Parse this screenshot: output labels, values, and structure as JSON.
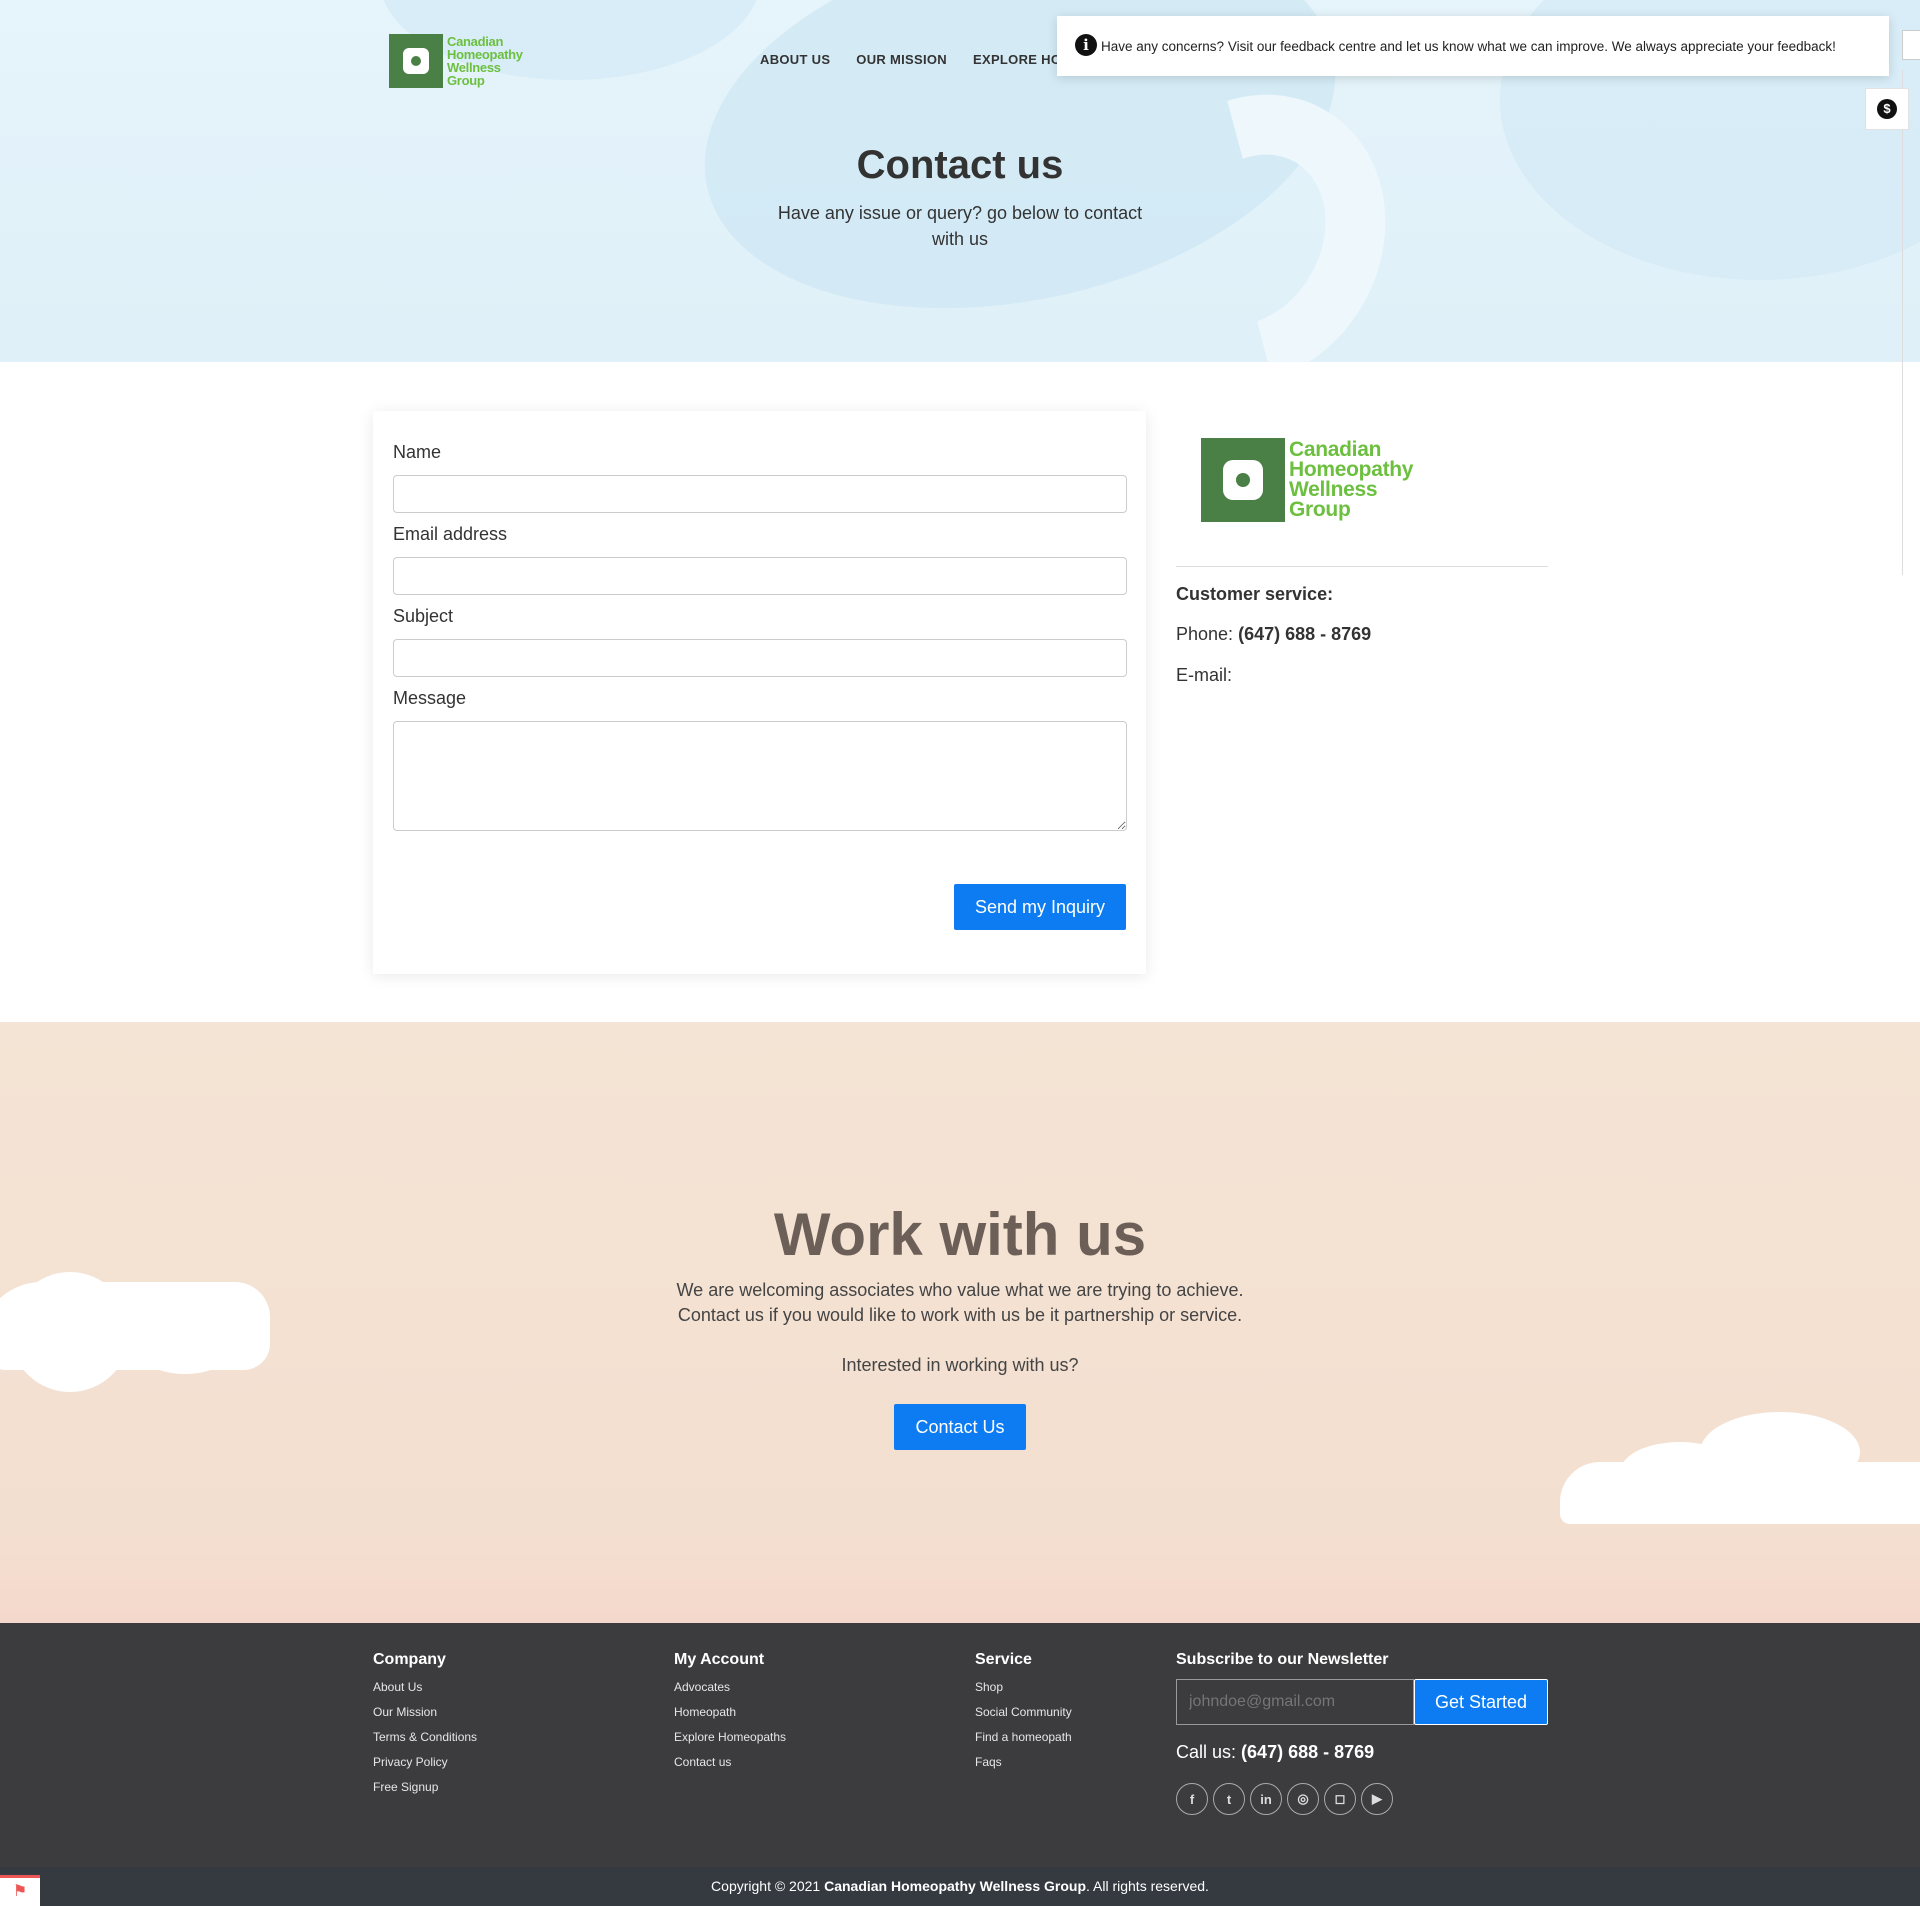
{
  "brand": {
    "line1": "Canadian",
    "line2": "Homeopathy",
    "line3": "Wellness",
    "line4": "Group",
    "color": "#6cbf3f",
    "mark_color": "#4a7f46"
  },
  "nav": {
    "items": [
      "ABOUT US",
      "OUR MISSION",
      "EXPLORE HOMEOPATHS"
    ]
  },
  "toast": {
    "icon": "info-icon",
    "text": "Have any concerns? Visit our feedback centre and let us know what we can improve. We always appreciate your feedback!"
  },
  "floating": {
    "icon": "dollar-icon",
    "glyph": "$"
  },
  "hero": {
    "title": "Contact us",
    "subtitle": "Have any issue or query? go below to contact with us"
  },
  "form": {
    "name_label": "Name",
    "email_label": "Email address",
    "subject_label": "Subject",
    "message_label": "Message",
    "name_value": "",
    "email_value": "",
    "subject_value": "",
    "message_value": "",
    "submit_label": "Send my Inquiry"
  },
  "contact_info": {
    "heading": "Customer service:",
    "phone_label": "Phone:",
    "phone_value": "(647) 688 - 8769",
    "email_label": "E-mail:",
    "email_value": ""
  },
  "work": {
    "title": "Work with us",
    "line1": "We are welcoming associates who value what we are trying to achieve.",
    "line2": "Contact us if you would like to work with us be it partnership or service.",
    "question": "Interested in working with us?",
    "button": "Contact Us"
  },
  "footer": {
    "company": {
      "heading": "Company",
      "links": [
        "About Us",
        "Our Mission",
        "Terms & Conditions",
        "Privacy Policy",
        "Free Signup"
      ]
    },
    "account": {
      "heading": "My Account",
      "links": [
        "Advocates",
        "Homeopath",
        "Explore Homeopaths",
        "Contact us"
      ]
    },
    "service": {
      "heading": "Service",
      "links": [
        "Shop",
        "Social Community",
        "Find a homeopath",
        "Faqs"
      ]
    },
    "newsletter": {
      "heading": "Subscribe to our Newsletter",
      "placeholder": "johndoe@gmail.com",
      "button": "Get Started"
    },
    "call_label": "Call us:",
    "call_value": "(647) 688 - 8769",
    "socials": [
      {
        "icon": "facebook-icon",
        "glyph": "f"
      },
      {
        "icon": "twitter-icon",
        "glyph": "t"
      },
      {
        "icon": "linkedin-icon",
        "glyph": "in"
      },
      {
        "icon": "dribbble-icon",
        "glyph": "◎"
      },
      {
        "icon": "instagram-icon",
        "glyph": "◻"
      },
      {
        "icon": "youtube-icon",
        "glyph": "▶"
      }
    ]
  },
  "copyright": {
    "prefix": "Copyright © 2021",
    "company": "Canadian Homeopathy Wellness Group",
    "suffix": ". All rights reserved."
  },
  "colors": {
    "primary_button": "#0d7cf2",
    "footer_bg": "#3c3c3e",
    "copyright_bg": "#343a40",
    "work_bg": "#f4e4d5",
    "hero_bg": "#e6f4fb"
  }
}
